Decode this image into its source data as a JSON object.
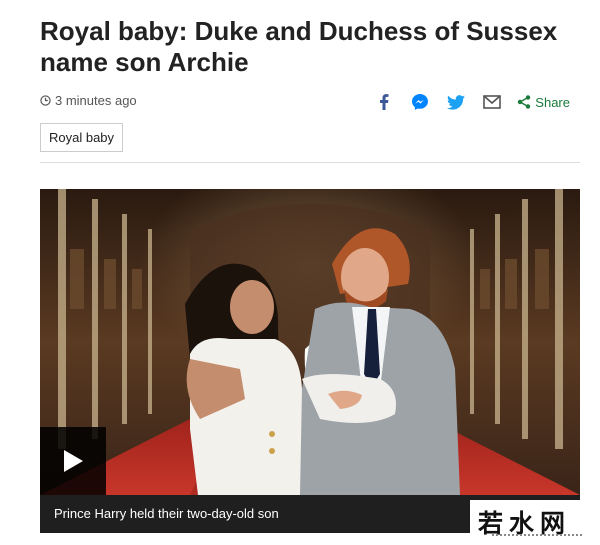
{
  "article": {
    "headline": "Royal baby: Duke and Duchess of Sussex name son Archie",
    "timestamp": "3 minutes ago",
    "tag": "Royal baby"
  },
  "share": {
    "label": "Share",
    "icons": [
      "facebook-icon",
      "messenger-icon",
      "twitter-icon",
      "email-icon",
      "share-icon"
    ]
  },
  "media": {
    "caption": "Prince Harry held their two-day-old son",
    "play_icon": "play-icon"
  },
  "watermark": {
    "text": "若水网"
  },
  "colors": {
    "headline": "#222222",
    "share_green": "#1a7a3a",
    "facebook": "#3b5998",
    "messenger": "#0084ff",
    "twitter": "#1da1f2",
    "caption_bg": "#1f1f1f"
  }
}
